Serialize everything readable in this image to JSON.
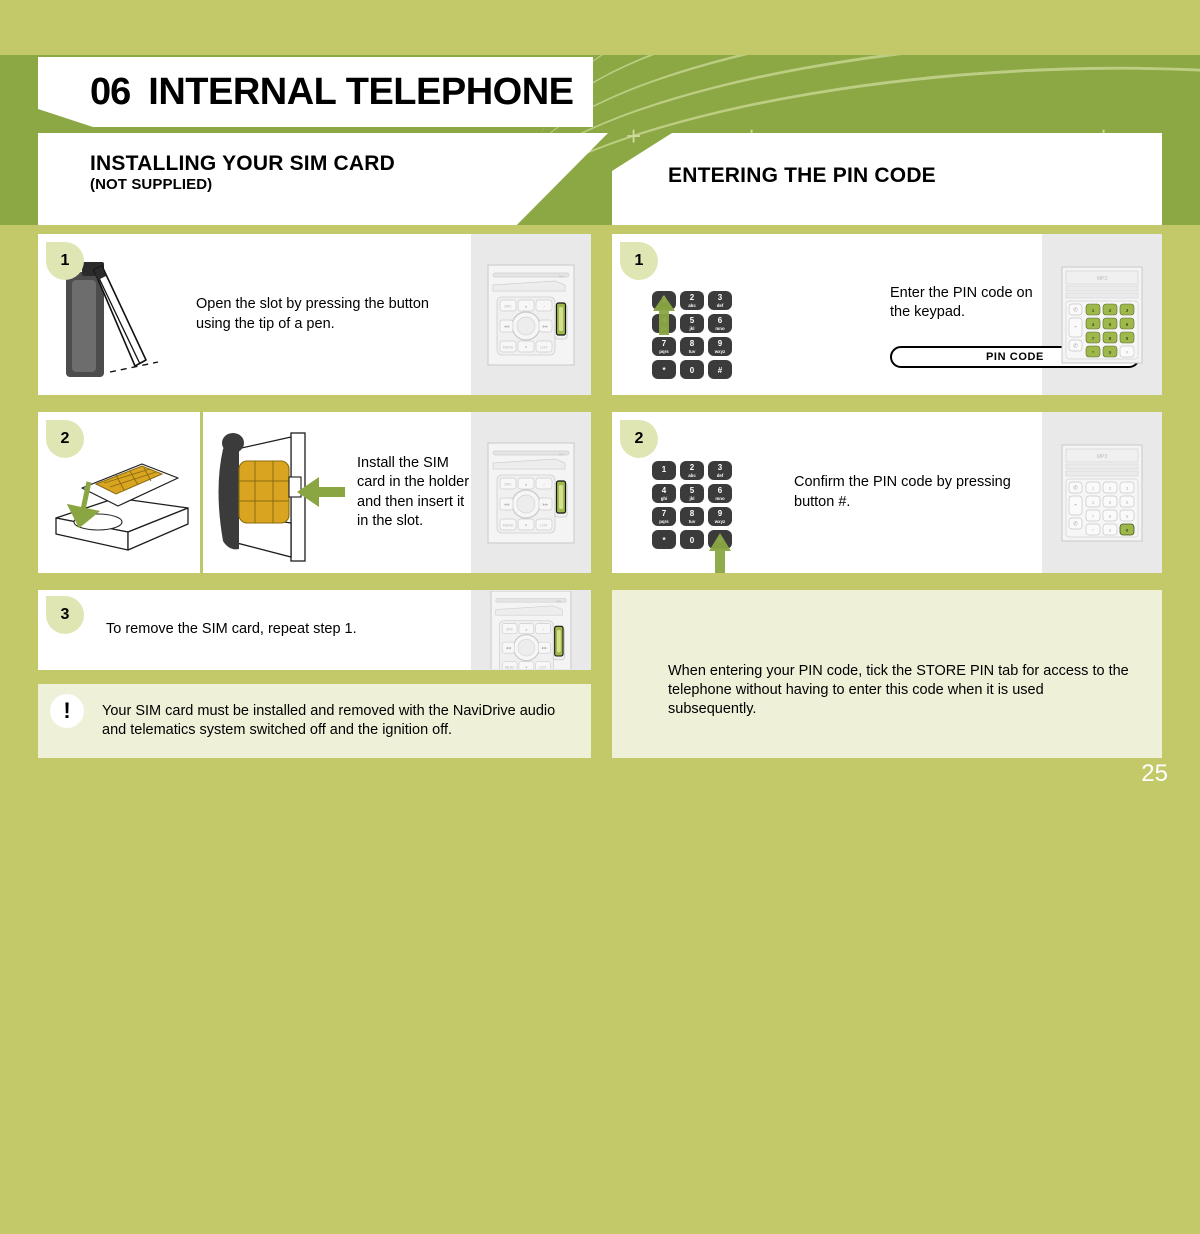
{
  "page": {
    "number": "25",
    "background_color": "#c3c968",
    "band_color": "#8ba844",
    "accent_color": "#8fa94a",
    "panel_aside_color": "#e9e9e9",
    "note_color": "#eef0d8"
  },
  "header": {
    "chapter_number": "06",
    "chapter_title": "INTERNAL TELEPHONE",
    "plus_marks": [
      "+",
      "+",
      "+"
    ]
  },
  "sections": {
    "left": {
      "title": "INSTALLING YOUR SIM CARD",
      "subtitle": "(NOT SUPPLIED)"
    },
    "right": {
      "title": "ENTERING THE PIN CODE"
    }
  },
  "left_steps": [
    {
      "number": "1",
      "text": "Open the slot by pressing the button using the tip of a pen.",
      "illustration": "pen-pressing-slot-button",
      "fascia": "navidrive-radio-controls",
      "fascia_highlight": "sim-slot"
    },
    {
      "number": "2",
      "text": "Install the SIM card in the holder and then insert it in the slot.",
      "illustration_a": "sim-card-into-tray",
      "illustration_b": "sim-holder-insert",
      "fascia": "navidrive-radio-controls",
      "fascia_highlight": "sim-slot"
    },
    {
      "number": "3",
      "text": "To remove the SIM card, repeat step 1.",
      "fascia": "navidrive-radio-controls",
      "fascia_highlight": "sim-slot"
    }
  ],
  "left_note": {
    "icon": "warning-exclamation-icon",
    "icon_glyph": "!",
    "text": "Your SIM card must be installed and removed with the NaviDrive audio and telematics system switched off and the ignition off."
  },
  "right_steps": [
    {
      "number": "1",
      "text": "Enter the PIN code on the keypad.",
      "pin_field_label": "PIN CODE",
      "arrow_target_key": "1",
      "fascia": "mp3-telephone-keypad",
      "fascia_label": "MP3",
      "fascia_highlight": "all-number-keys"
    },
    {
      "number": "2",
      "text": "Confirm the PIN code by pressing button #.",
      "arrow_target_key": "#",
      "fascia": "mp3-telephone-keypad",
      "fascia_label": "MP3",
      "fascia_highlight": "hash-key"
    }
  ],
  "right_note": {
    "icon": "tip-lightbulb-icon",
    "text": "When entering your PIN code, tick the STORE PIN tab for access to the telephone without having to enter this code when it is used subsequently."
  },
  "keypad": {
    "keys": [
      {
        "digit": "1",
        "letters": ""
      },
      {
        "digit": "2",
        "letters": "abc"
      },
      {
        "digit": "3",
        "letters": "def"
      },
      {
        "digit": "4",
        "letters": "ghi"
      },
      {
        "digit": "5",
        "letters": "jkl"
      },
      {
        "digit": "6",
        "letters": "mno"
      },
      {
        "digit": "7",
        "letters": "pqrs"
      },
      {
        "digit": "8",
        "letters": "tuv"
      },
      {
        "digit": "9",
        "letters": "wxyz"
      },
      {
        "digit": "*",
        "letters": ""
      },
      {
        "digit": "0",
        "letters": ""
      },
      {
        "digit": "#",
        "letters": ""
      }
    ]
  },
  "radio_controls": {
    "buttons": [
      "SRC",
      "MENU",
      "LIST"
    ],
    "slot_label": "SIM"
  }
}
